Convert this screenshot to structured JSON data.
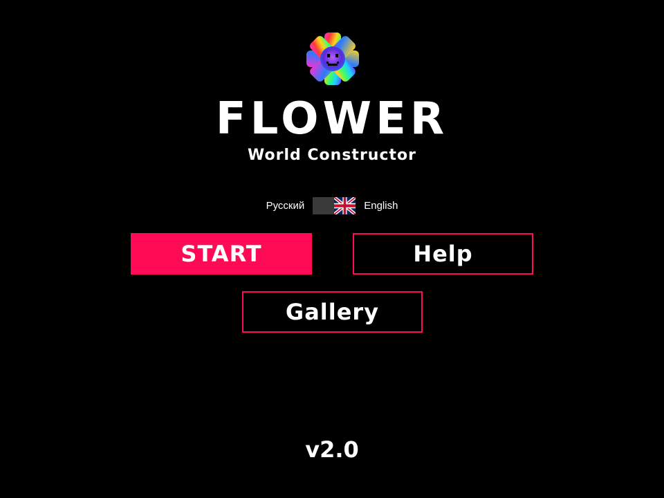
{
  "app": {
    "logo_icon": "rainbow-pixel-flower-icon",
    "title": "FLOWER",
    "subtitle": "World Constructor",
    "version": "v2.0"
  },
  "language": {
    "left_label": "Русский",
    "right_label": "English",
    "selected": "English",
    "flag_icon": "uk-flag-icon"
  },
  "menu": {
    "start_label": "START",
    "help_label": "Help",
    "gallery_label": "Gallery"
  },
  "colors": {
    "background": "#000000",
    "accent": "#ff0a55",
    "text": "#ffffff",
    "toggle_track": "#3a3a3a"
  }
}
